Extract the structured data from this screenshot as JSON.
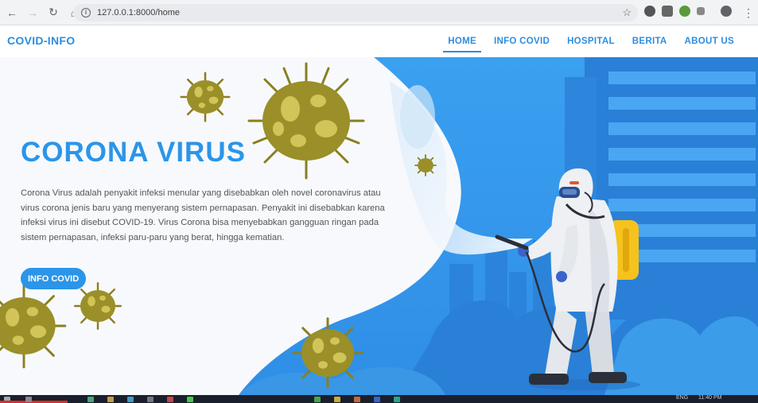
{
  "browser": {
    "url": "127.0.0.1:8000/home"
  },
  "navbar": {
    "brand": "COVID-INFO",
    "items": [
      {
        "label": "HOME",
        "active": true
      },
      {
        "label": "INFO COVID",
        "active": false
      },
      {
        "label": "HOSPITAL",
        "active": false
      },
      {
        "label": "BERITA",
        "active": false
      },
      {
        "label": "ABOUT US",
        "active": false
      }
    ]
  },
  "hero": {
    "title": "CORONA VIRUS",
    "description": "Corona Virus adalah penyakit infeksi menular yang disebabkan oleh novel coronavirus atau virus corona jenis baru yang menyerang sistem pernapasan. Penyakit ini disebabkan karena infeksi virus ini disebut COVID-19. Virus Corona bisa menyebabkan gangguan ringan pada sistem pernapasan, infeksi paru-paru yang berat, hingga kematian.",
    "button_label": "INFO COVID"
  },
  "taskbar": {
    "language": "ENG",
    "time": "11:40 PM"
  },
  "colors": {
    "accent": "#2b95e9",
    "virus": "#9a8f28",
    "city": "#2a82d8"
  }
}
